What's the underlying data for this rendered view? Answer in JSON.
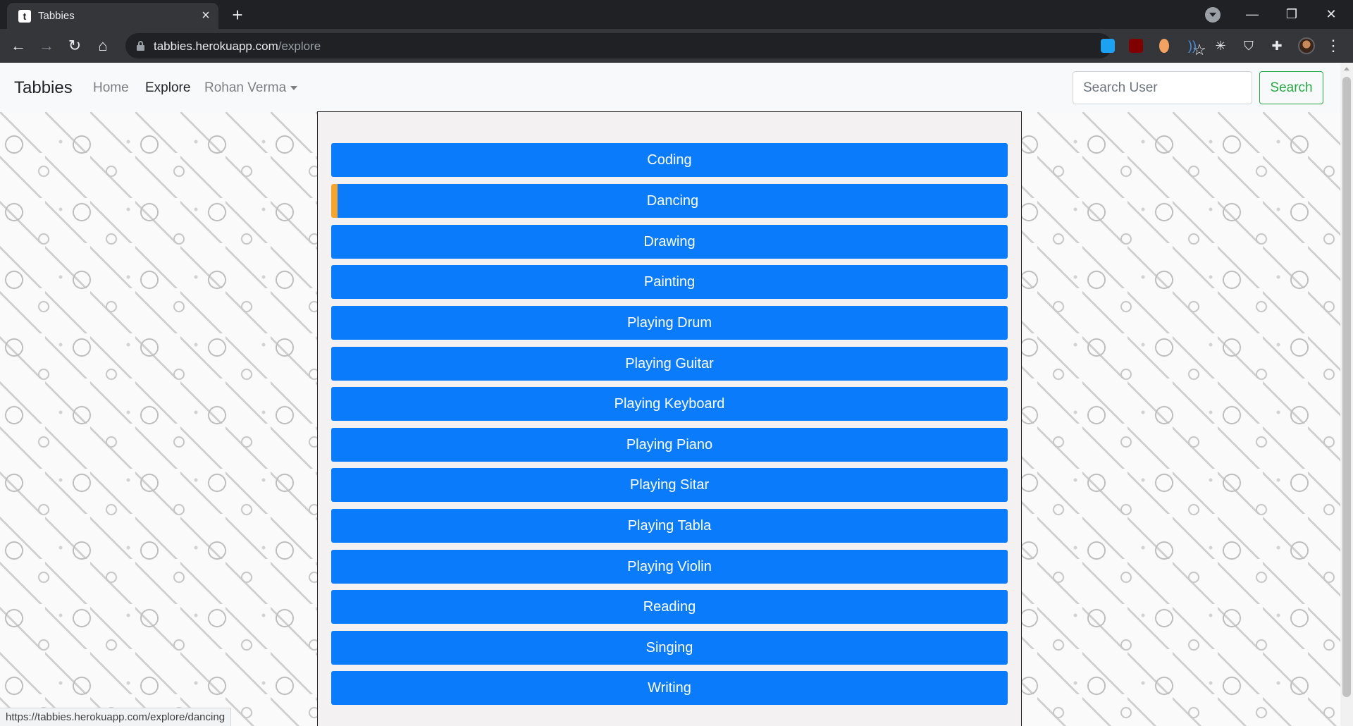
{
  "browser": {
    "tab_title": "Tabbies",
    "tab_favicon": "t",
    "url_host": "tabbies.herokuapp.com",
    "url_path": "/explore",
    "status_url": "https://tabbies.herokuapp.com/explore/dancing"
  },
  "navbar": {
    "brand": "Tabbies",
    "links": [
      "Home",
      "Explore"
    ],
    "active_link": "Explore",
    "user_menu": "Rohan Verma",
    "search_placeholder": "Search User",
    "search_button": "Search"
  },
  "categories": [
    "Coding",
    "Dancing",
    "Drawing",
    "Painting",
    "Playing Drum",
    "Playing Guitar",
    "Playing Keyboard",
    "Playing Piano",
    "Playing Sitar",
    "Playing Tabla",
    "Playing Violin",
    "Reading",
    "Singing",
    "Writing"
  ],
  "hovered_category": "Dancing",
  "colors": {
    "category_button": "#0a7cfb",
    "hover_accent": "#f5a52b",
    "search_button": "#28a745"
  },
  "icons": [
    "back-arrow-icon",
    "forward-arrow-icon",
    "reload-icon",
    "home-icon",
    "lock-icon",
    "star-icon",
    "extensions-icon",
    "menu-dots-icon"
  ]
}
